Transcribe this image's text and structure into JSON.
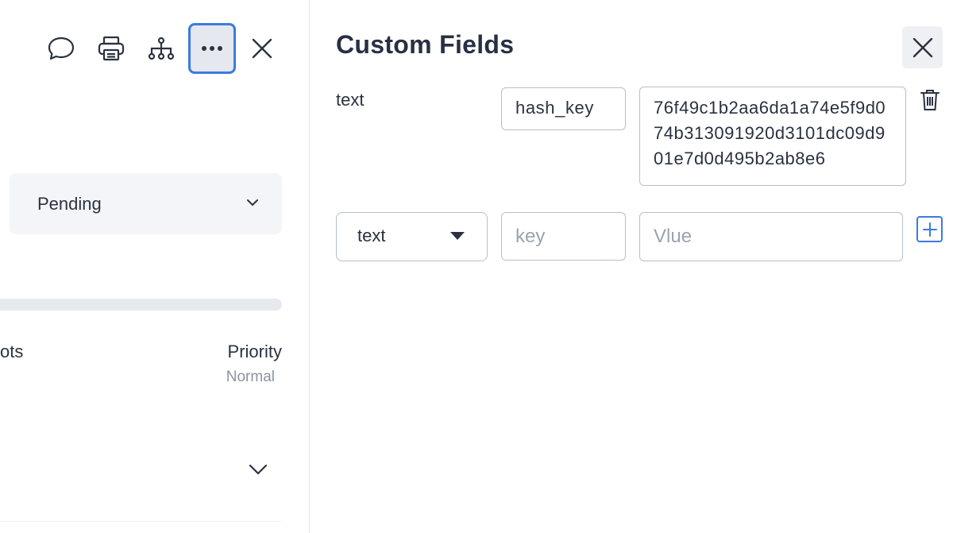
{
  "toolbar": {
    "icons": [
      "comment-icon",
      "print-icon",
      "hierarchy-icon",
      "more-icon",
      "close-icon"
    ]
  },
  "status": {
    "selected": "Pending"
  },
  "meta": {
    "partial_column_label": "ots",
    "priority_label": "Priority",
    "priority_value": "Normal"
  },
  "custom_fields": {
    "title": "Custom Fields",
    "existing": [
      {
        "type": "text",
        "key": "hash_key",
        "value": "76f49c1b2aa6da1a74e5f9d074b313091920d3101dc09d901e7d0d495b2ab8e6"
      }
    ],
    "new_field": {
      "type_selected": "text",
      "key_placeholder": "key",
      "value_placeholder": "Vlue"
    }
  },
  "colors": {
    "accent": "#3b7be0",
    "text": "#2a3240",
    "muted": "#8a94a3",
    "border": "#b8bec8"
  }
}
